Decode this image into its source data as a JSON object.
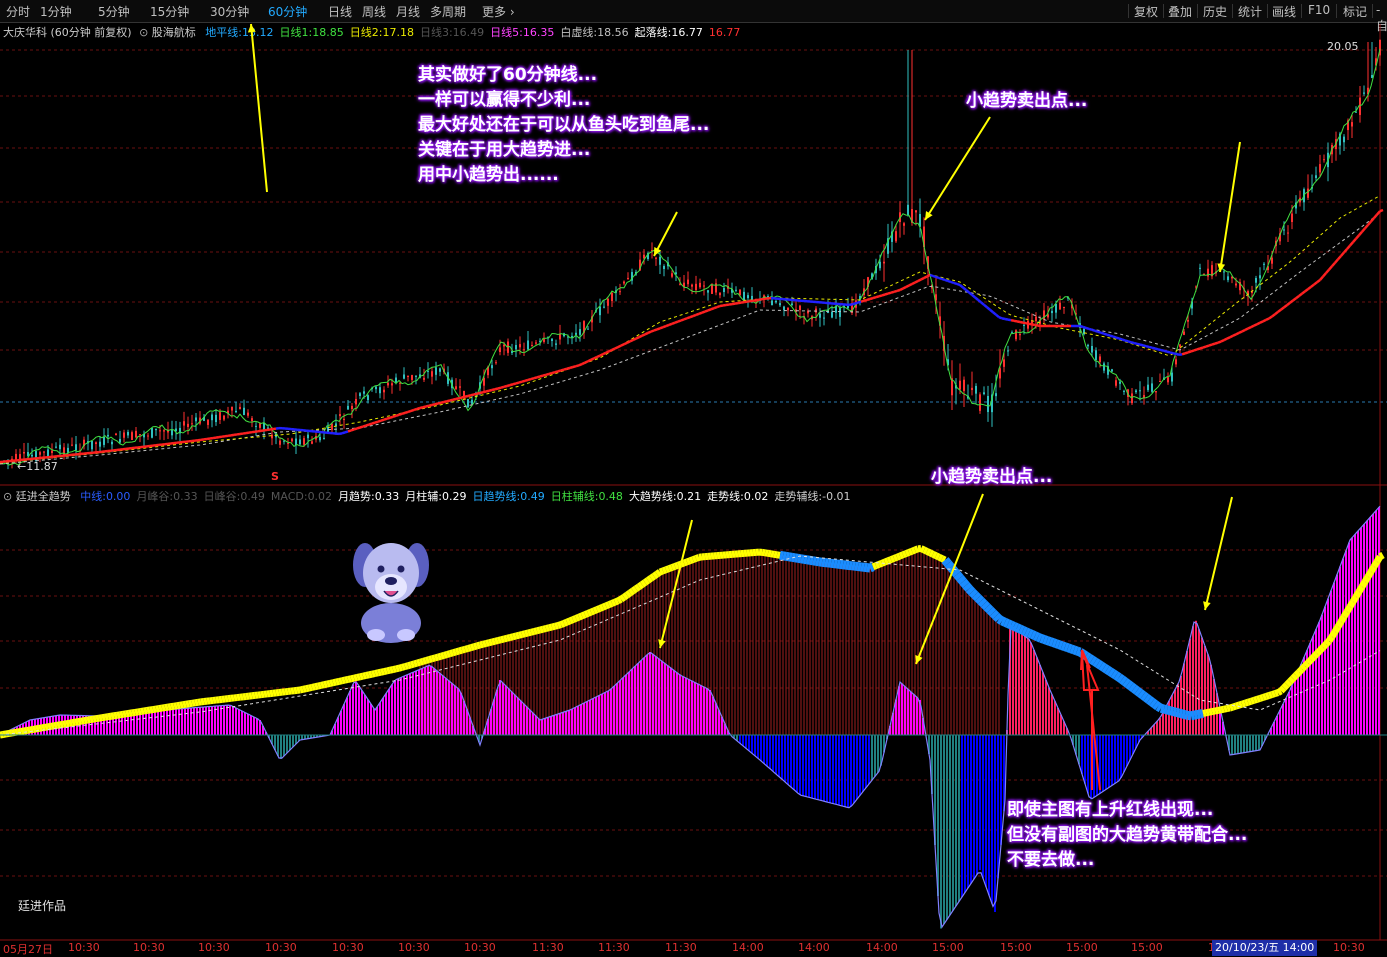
{
  "toolbar": {
    "periods": [
      "分时",
      "1分钟",
      "5分钟",
      "15分钟",
      "30分钟",
      "60分钟",
      "日线",
      "周线",
      "月线",
      "多周期",
      "更多"
    ],
    "active_period": "60分钟",
    "right_buttons": [
      "复权",
      "叠加",
      "历史",
      "统计",
      "画线",
      "F10",
      "标记",
      "-自"
    ]
  },
  "main_legend": {
    "stock": "大庆华科 (60分钟 前复权)",
    "indicator": "股海航标",
    "items": [
      {
        "name": "地平线",
        "value": "13.12",
        "color": "#22aaff"
      },
      {
        "name": "日线1",
        "value": "18.85",
        "color": "#40e040"
      },
      {
        "name": "日线2",
        "value": "17.18",
        "color": "#e8e800"
      },
      {
        "name": "日线3",
        "value": "16.49",
        "color": "#555555"
      },
      {
        "name": "日线5",
        "value": "16.35",
        "color": "#ff44ff"
      },
      {
        "name": "白虚线",
        "value": "18.56",
        "color": "#c0c0c0"
      },
      {
        "name": "起落线",
        "value": "16.77",
        "color": "#ffffff"
      },
      {
        "name": "",
        "value": "16.77",
        "color": "#ff3030"
      }
    ]
  },
  "main_prices": {
    "high": "20.05",
    "low": "11.87"
  },
  "sub_legend": {
    "indicator": "廷进全趋势",
    "items": [
      {
        "name": "中线",
        "value": "0.00",
        "color": "#2a5cff"
      },
      {
        "name": "月峰谷",
        "value": "0.33",
        "color": "#555555"
      },
      {
        "name": "日峰谷",
        "value": "0.49",
        "color": "#555555"
      },
      {
        "name": "MACD",
        "value": "0.02",
        "color": "#555555"
      },
      {
        "name": "月趋势",
        "value": "0.33",
        "color": "#ffffff"
      },
      {
        "name": "月柱辅",
        "value": "0.29",
        "color": "#ffffff"
      },
      {
        "name": "日趋势线",
        "value": "0.49",
        "color": "#22aaff"
      },
      {
        "name": "日柱辅线",
        "value": "0.48",
        "color": "#40e040"
      },
      {
        "name": "大趋势线",
        "value": "0.21",
        "color": "#ffffff"
      },
      {
        "name": "走势线",
        "value": "0.02",
        "color": "#ffffff"
      },
      {
        "name": "走势辅线",
        "value": "-0.01",
        "color": "#cccccc"
      }
    ]
  },
  "annotations": {
    "top_left": [
      "其实做好了60分钟线...",
      "一样可以赢得不少利...",
      "最大好处还在于可以从鱼头吃到鱼尾...",
      "关键在于用大趋势进...",
      "用中小趋势出......"
    ],
    "top_right": "小趋势卖出点...",
    "sub_top": "小趋势卖出点...",
    "sub_bottom": [
      "即使主图有上升红线出现...",
      "但没有副图的大趋势黄带配合...",
      "不要去做..."
    ]
  },
  "signature": "廷进作品",
  "s_marker": "S",
  "time_axis": {
    "labels": [
      "05月27日",
      "10:30",
      "10:30",
      "10:30",
      "10:30",
      "10:30",
      "10:30",
      "10:30",
      "11:30",
      "11:30",
      "11:30",
      "14:00",
      "14:00",
      "14:00",
      "15:00",
      "15:00",
      "15:00",
      "15:00",
      "10",
      "10:30"
    ],
    "cursor_label": "20/10/23/五 14:00"
  },
  "colors": {
    "up": "#ff3030",
    "down": "#30c0c0",
    "trend_red": "#ff2020",
    "trend_blue": "#2020ff",
    "yellow": "#ffff00",
    "magenta": "#ff00ff",
    "teal": "#208080",
    "blue_fill": "#0000ff",
    "annotation": "#a020ff"
  }
}
